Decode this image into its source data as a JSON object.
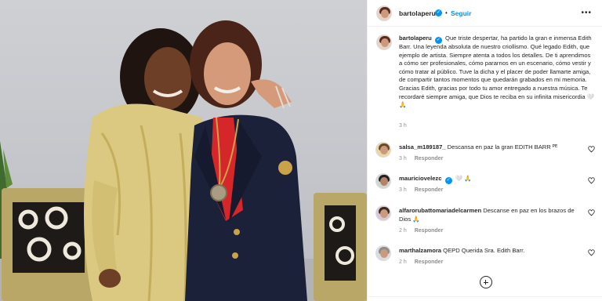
{
  "post": {
    "author": "bartolaperu",
    "follow_label": "Seguir",
    "separator": "•",
    "more_label": "•••",
    "caption": "Que triste despertar, ha partido la gran e inmensa Edith Barr. Una leyenda absoluta de nuestro criollismo. Qué legado Edith, que ejemplo de artista. Siempre atenta a todos los detalles. De ti aprendimos a cómo ser profesionales, cómo pararnos en un escenario, cómo vestir y cómo tratar al público. Tuve la dicha y el placer de poder llamarte amiga, de compartir tantos momentos que quedarán grabados en mi memoria. Gracias Edith, gracias por todo tu amor entregado a nuestra música. Te recordaré siempre amiga, que Dios te reciba en su infinita misericordia 🤍 🙏",
    "caption_time": "3 h"
  },
  "comments": [
    {
      "user": "salsa_m189187_",
      "text": "Descansa en paz la gran EDITH BARR ᴾᴱ",
      "time": "3 h",
      "reply": "Responder",
      "verified": false
    },
    {
      "user": "mauriciovelezc",
      "text": "🤍 🙏",
      "time": "3 h",
      "reply": "Responder",
      "verified": true
    },
    {
      "user": "alfarorubattomariadelcarmen",
      "text": "Descanse en paz en los brazos de Dios 🙏",
      "time": "2 h",
      "reply": "Responder",
      "verified": false
    },
    {
      "user": "marthalzamora",
      "text": "QEPD Querida Sra. Edith Barr.",
      "time": "2 h",
      "reply": "Responder",
      "verified": false
    }
  ],
  "icons": {
    "verified": "verified-badge-icon",
    "heart": "heart-outline-icon",
    "more": "more-options-icon",
    "load_more": "plus-circle-icon"
  },
  "colors": {
    "link": "#0095f6",
    "verified": "#0095f6",
    "muted": "#8e8e8e",
    "text": "#262626"
  }
}
